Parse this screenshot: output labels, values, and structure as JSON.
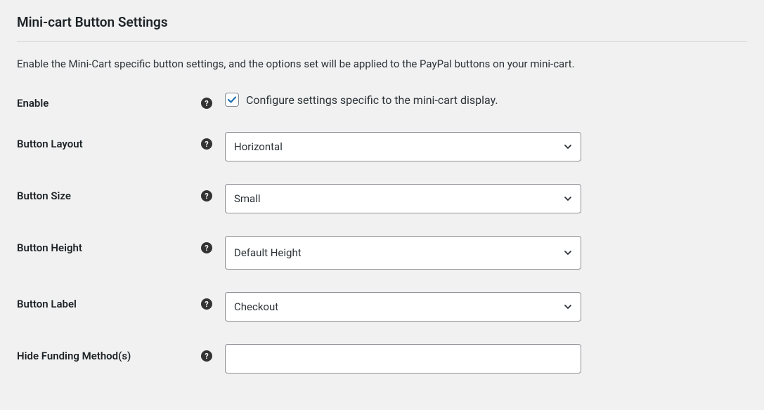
{
  "section": {
    "title": "Mini-cart Button Settings",
    "description": "Enable the Mini-Cart specific button settings, and the options set will be applied to the PayPal buttons on your mini-cart."
  },
  "fields": {
    "enable": {
      "label": "Enable",
      "checkbox_label": "Configure settings specific to the mini-cart display."
    },
    "layout": {
      "label": "Button Layout",
      "value": "Horizontal"
    },
    "size": {
      "label": "Button Size",
      "value": "Small"
    },
    "height": {
      "label": "Button Height",
      "value": "Default Height"
    },
    "btn_label": {
      "label": "Button Label",
      "value": "Checkout"
    },
    "hide_funding": {
      "label": "Hide Funding Method(s)",
      "value": ""
    }
  }
}
